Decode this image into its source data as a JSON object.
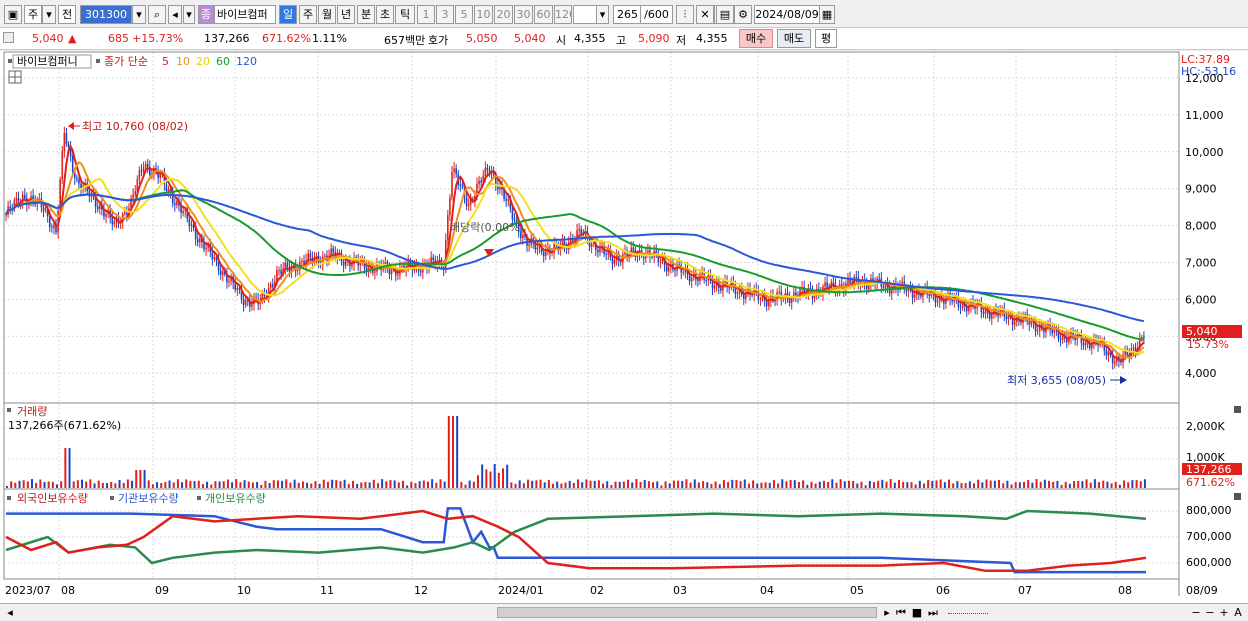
{
  "toolbar": {
    "market": "주",
    "prev": "전",
    "code": "301300",
    "name_badge": "종",
    "name": "바이브컴퍼",
    "periods": [
      "일",
      "주",
      "월",
      "년",
      "분",
      "초",
      "틱"
    ],
    "active_period": "일",
    "intervals": [
      "1",
      "3",
      "5",
      "10",
      "20",
      "30",
      "60",
      "120"
    ],
    "count": "265",
    "count_total": "/600",
    "date": "2024/08/09"
  },
  "info": {
    "price": "5,040",
    "change": "685",
    "change_pct": "+15.73%",
    "volume": "137,266",
    "volume_pct": "671.62%",
    "turnover": "1.11%",
    "amount": "657백만",
    "ask_label": "호가",
    "ask_value": "5,050",
    "bid_value": "5,040",
    "open_label": "시",
    "open_value": "4,355",
    "high_label": "고",
    "high_value": "5,090",
    "low_label": "저",
    "low_value": "4,355",
    "buy_button": "매수",
    "sell_button": "매도",
    "eval_button": "평"
  },
  "legend": {
    "stock_name": "바이브컴퍼니",
    "ma_label": "종가 단순",
    "ma_periods": [
      "5",
      "10",
      "20",
      "60",
      "120"
    ],
    "ma_colors": [
      "#e0201a",
      "#f0901a",
      "#f2e020",
      "#1a9a30",
      "#2a58d8"
    ]
  },
  "price_chart": {
    "lc": "LC:37.89",
    "hc": "HC:-53.16",
    "y_ticks": [
      "12,000",
      "11,000",
      "10,000",
      "9,000",
      "8,000",
      "7,000",
      "6,000",
      "5,000",
      "4,000"
    ],
    "current_price": "5,040",
    "current_pct": "15.73%",
    "high_annotation": "최고 10,760 (08/02)",
    "low_annotation": "최저 3,655 (08/05)",
    "dividend_annotation": "배당락(0.00%)"
  },
  "volume_chart": {
    "title": "거래량",
    "summary": "137,266주(671.62%)",
    "y_ticks": [
      "2,000K",
      "1,000K"
    ],
    "current": "137,266",
    "current_pct": "671.62%"
  },
  "holdings_chart": {
    "legend": [
      "외국인보유수량",
      "기관보유수량",
      "개인보유수량"
    ],
    "legend_colors": [
      "#e0201a",
      "#2a58d8",
      "#2a8a50"
    ],
    "y_ticks": [
      "800,000",
      "700,000",
      "600,000"
    ]
  },
  "x_axis": {
    "labels": [
      "2023/07",
      "08",
      "09",
      "10",
      "11",
      "12",
      "2024/01",
      "02",
      "03",
      "04",
      "05",
      "06",
      "07",
      "08",
      "08/09"
    ]
  }
}
